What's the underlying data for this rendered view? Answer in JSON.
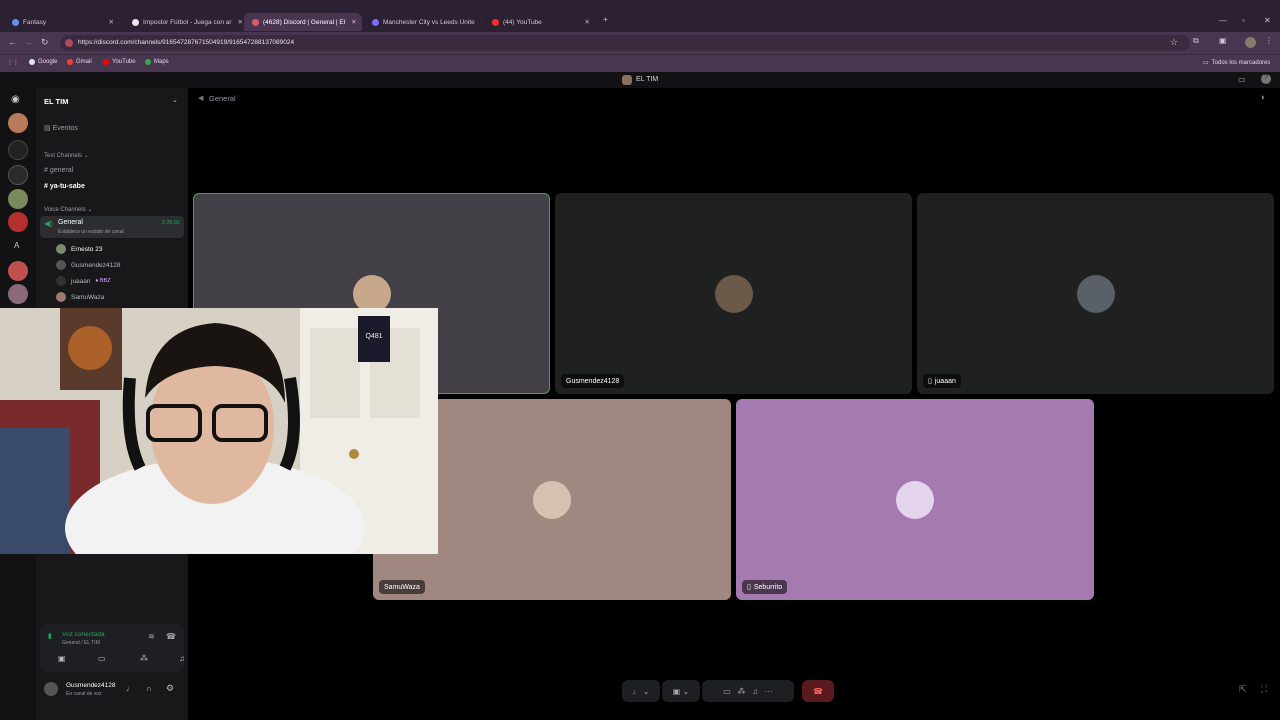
{
  "browser": {
    "tabs": [
      {
        "label": "Fantasy",
        "color": "#6a8cff"
      },
      {
        "label": "Impostor Fútbol - Juega con ar",
        "color": "#e8e8e8"
      },
      {
        "label": "(4628) Discord | General | El",
        "color": "#e0566d"
      },
      {
        "label": "Manchester City vs Leeds Unite",
        "color": "#7a6cff"
      },
      {
        "label": "(44) YouTube",
        "color": "#ff2a2a"
      }
    ],
    "url": "https://discord.com/channels/916547287671504919/916547288137089024",
    "bookmarks": [
      {
        "label": "Google",
        "color": "#dfe3e8"
      },
      {
        "label": "Gmail",
        "color": "#ea4335"
      },
      {
        "label": "YouTube",
        "color": "#ff0000"
      },
      {
        "label": "Maps",
        "color": "#34a853"
      }
    ],
    "all_bookmarks": "Todos los marcadores"
  },
  "discord": {
    "window_title": "EL TIM",
    "server_name": "EL TIM",
    "events_label": "Eventos",
    "text_category": "Text Channels",
    "text_channels": [
      "general",
      "ya-tu-sabe"
    ],
    "voice_category": "Voice Channels",
    "voice_channel": {
      "name": "General",
      "timer": "3:26:02",
      "status": "Establece un estado de canal"
    },
    "voice_users": [
      {
        "name": "Ernesto 23",
        "color": "#7a8a6a"
      },
      {
        "name": "Gusmendez4128",
        "color": "#555"
      },
      {
        "name": "juaaan",
        "color": "#333",
        "tag": "BBZ"
      },
      {
        "name": "SamuWaza",
        "color": "#a07a70"
      }
    ],
    "channel_header": "General",
    "voice_connected": {
      "label": "Voz conectada",
      "sub": "General / EL TIM"
    },
    "user_panel": {
      "name": "Gusmendez4128",
      "status": "En canal de voz"
    },
    "tiles": [
      {
        "name": "",
        "bg": "#444048",
        "avatar": "#c7a88a",
        "border": "#3ba55c"
      },
      {
        "name": "Gusmendez4128",
        "bg": "#1f2020",
        "avatar": "#6b5a4a"
      },
      {
        "name": "juaaan",
        "bg": "#1f2020",
        "avatar": "#5a6068"
      },
      {
        "name": "SamuWaza",
        "bg": "#a08880",
        "avatar": "#d8c0b0"
      },
      {
        "name": "Seburrito",
        "bg": "#a47ab0",
        "avatar": "#e4d4ec"
      }
    ]
  },
  "webcam": {
    "jersey_number": "Q481"
  }
}
